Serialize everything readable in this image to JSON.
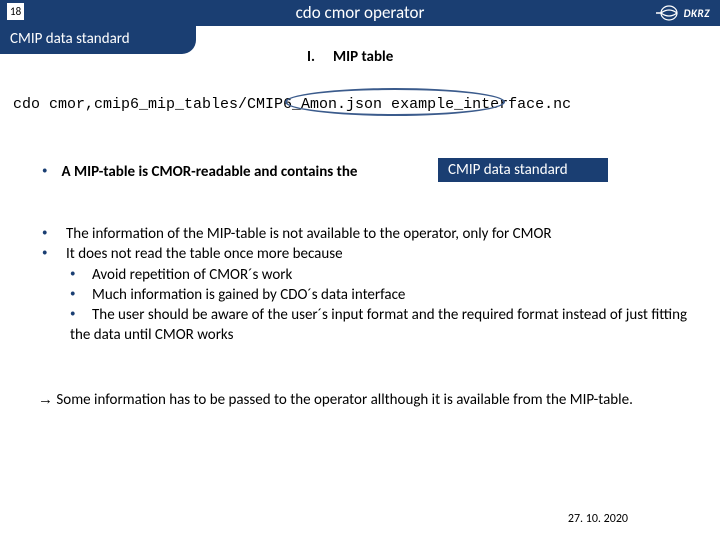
{
  "header": {
    "page_number": "18",
    "title": "cdo cmor operator",
    "logo_text": "DKRZ"
  },
  "subtitle_tab": "CMIP data standard",
  "section": {
    "number": "I.",
    "label": "MIP table"
  },
  "command_line": "cdo cmor,cmip6_mip_tables/CMIP6_Amon.json example_interface.nc",
  "bullet1": {
    "text_prefix": "A MIP-table is CMOR-readable and contains the",
    "tag": "CMIP data standard"
  },
  "bullet2": {
    "line1": "The information of the MIP-table is not available to the operator, only for CMOR",
    "line2": "It does not read the table once more because",
    "sub1": "Avoid repetition of CMOR´s work",
    "sub2": "Much information is gained by CDO´s data interface",
    "sub3": "The user should be aware of the user´s input format and the required format instead of just fitting the data until CMOR works"
  },
  "conclusion": {
    "arrow": "→",
    "text": " Some information has to be passed to the operator allthough it is available from the MIP-table."
  },
  "footer": {
    "date": "27. 10. 2020"
  }
}
